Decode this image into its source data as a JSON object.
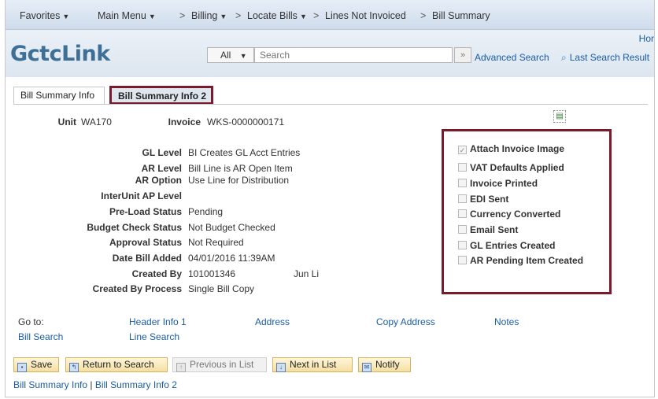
{
  "nav": {
    "favorites": "Favorites",
    "main_menu": "Main Menu",
    "billing": "Billing",
    "locate_bills": "Locate Bills",
    "lines_not_invoiced": "Lines Not Invoiced",
    "bill_summary": "Bill Summary",
    "separator": ">"
  },
  "branding": {
    "logo_text": "ctcLink",
    "logo_glyph": "G",
    "home_link": "Hor"
  },
  "search": {
    "scope": "All",
    "placeholder": "Search",
    "go_symbol": "»",
    "advanced_search": "Advanced Search",
    "last_search_results": "Last Search Result"
  },
  "tabs": {
    "bill_summary_info": "Bill Summary Info",
    "bill_summary_info_2": "Bill Summary Info 2"
  },
  "header": {
    "unit_label": "Unit",
    "unit_value": "WA170",
    "invoice_label": "Invoice",
    "invoice_value": "WKS-0000000171"
  },
  "fields": {
    "gl_level_label": "GL Level",
    "gl_level_value": "BI Creates GL Acct Entries",
    "ar_level_label": "AR Level",
    "ar_level_value": "Bill Line is AR Open Item",
    "ar_option_label": "AR Option",
    "ar_option_value": "Use Line for Distribution",
    "interunit_label": "InterUnit AP Level",
    "preload_label": "Pre-Load Status",
    "preload_value": "Pending",
    "budget_label": "Budget Check Status",
    "budget_value": "Not Budget Checked",
    "approval_label": "Approval Status",
    "approval_value": "Not Required",
    "date_added_label": "Date Bill Added",
    "date_added_value": "04/01/2016 11:39AM",
    "created_by_label": "Created By",
    "created_by_id": "101001346",
    "created_by_name": "Jun Li",
    "created_by_process_label": "Created By Process",
    "created_by_process_value": "Single Bill Copy"
  },
  "checkboxes": [
    {
      "label": "Attach Invoice Image",
      "checked": true
    },
    {
      "label": "VAT Defaults Applied",
      "checked": false
    },
    {
      "label": "Invoice Printed",
      "checked": false
    },
    {
      "label": "EDI Sent",
      "checked": false
    },
    {
      "label": "Currency Converted",
      "checked": false
    },
    {
      "label": "Email Sent",
      "checked": false
    },
    {
      "label": "GL Entries Created",
      "checked": false
    },
    {
      "label": "AR Pending Item Created",
      "checked": false
    }
  ],
  "goto": {
    "label": "Go to:",
    "header_info_1": "Header Info 1",
    "address": "Address",
    "copy_address": "Copy Address",
    "notes": "Notes",
    "bill_search": "Bill Search",
    "line_search": "Line Search"
  },
  "toolbar": {
    "save": "Save",
    "return_to_search": "Return to Search",
    "previous_in_list": "Previous in List",
    "next_in_list": "Next in List",
    "notify": "Notify"
  },
  "footer_links": {
    "link1": "Bill Summary Info",
    "divider": "|",
    "link2": "Bill Summary Info 2"
  },
  "colors": {
    "highlight_border": "#7a1a2c",
    "link": "#1a5ca8",
    "logo": "#3d6f97"
  }
}
